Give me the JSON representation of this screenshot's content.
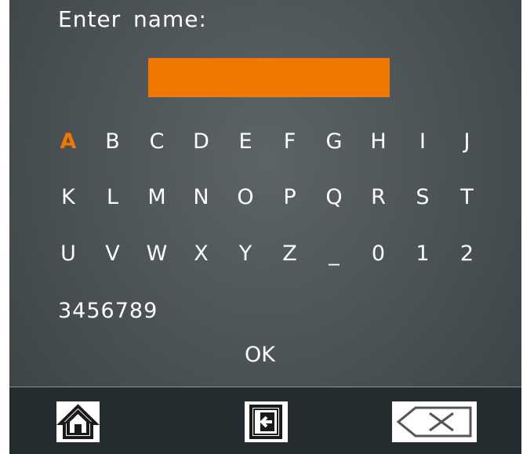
{
  "prompt": "Enter name:",
  "name_field": {
    "value": ""
  },
  "keyboard": {
    "rows": [
      [
        "A",
        "B",
        "C",
        "D",
        "E",
        "F",
        "G",
        "H",
        "I",
        "J"
      ],
      [
        "K",
        "L",
        "M",
        "N",
        "O",
        "P",
        "Q",
        "R",
        "S",
        "T"
      ],
      [
        "U",
        "V",
        "W",
        "X",
        "Y",
        "Z",
        "_",
        "0",
        "1",
        "2"
      ]
    ],
    "digits": "3456789",
    "selected": "A",
    "ok_label": "OK"
  },
  "bottom_bar": {
    "icons": [
      "home-icon",
      "exit-icon",
      "backspace-icon"
    ]
  },
  "colors": {
    "accent": "#f07800",
    "background": "#4a5155",
    "bar": "#242c30"
  }
}
